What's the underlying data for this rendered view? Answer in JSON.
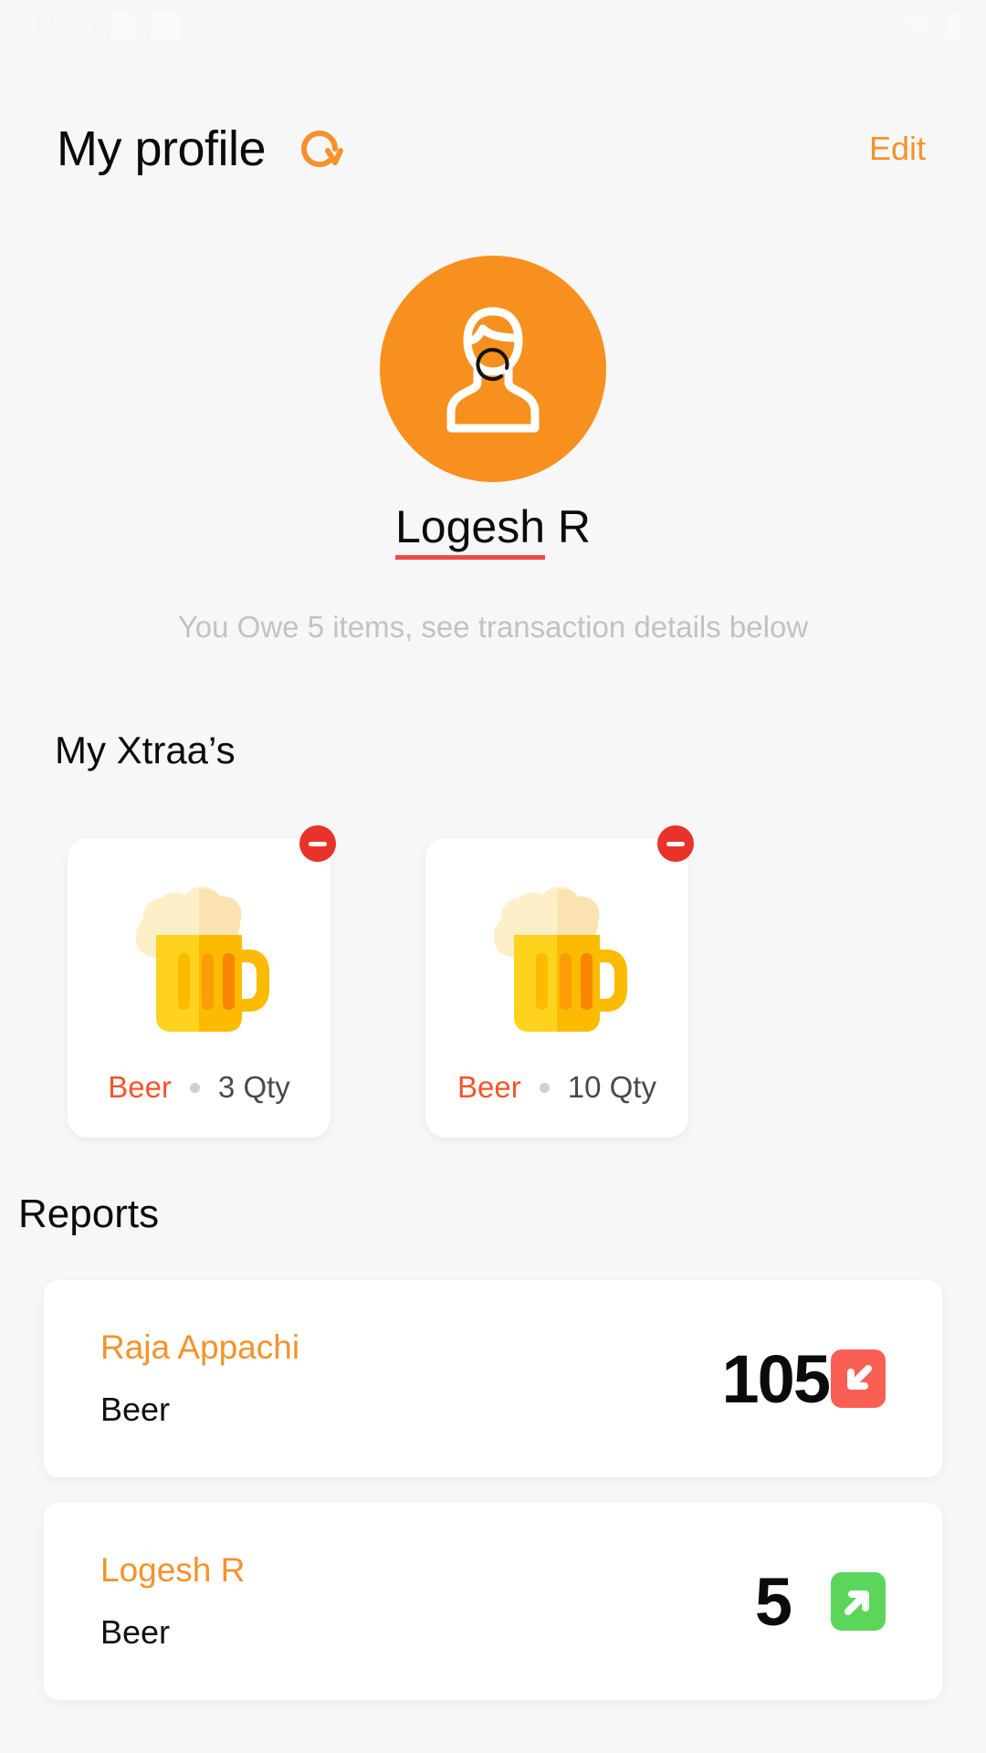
{
  "status_bar": {
    "time": "11:24",
    "icons": [
      "app-square-icon",
      "app-square-icon",
      "wifi-icon",
      "battery-icon"
    ]
  },
  "header": {
    "title": "My profile",
    "refresh_icon": "refresh-icon",
    "edit_label": "Edit"
  },
  "profile": {
    "avatar_icon": "person-avatar-icon",
    "avatar_color": "#F7901E",
    "spinner_icon": "loading-spinner-icon",
    "name_first": "Logesh",
    "name_last": " R",
    "subtitle": "You Owe 5 items, see transaction details below",
    "underline_color": "#EE4B4B"
  },
  "xtraa": {
    "section_title": "My Xtraa’s",
    "items": [
      {
        "image_icon": "beer-mug-icon",
        "name": "Beer",
        "qty": "3 Qty",
        "remove_icon": "minus-circle-icon",
        "remove_color": "#E8332A"
      },
      {
        "image_icon": "beer-mug-icon",
        "name": "Beer",
        "qty": "10 Qty",
        "remove_icon": "minus-circle-icon",
        "remove_color": "#E8332A"
      }
    ]
  },
  "reports": {
    "section_title": "Reports",
    "rows": [
      {
        "person": "Raja Appachi",
        "item": "Beer",
        "value": "105",
        "direction_icon": "arrow-down-left-icon",
        "badge_color": "#FA5F55"
      },
      {
        "person": "Logesh R",
        "item": "Beer",
        "value": "5",
        "direction_icon": "arrow-up-right-icon",
        "badge_color": "#5BD65B"
      }
    ]
  },
  "colors": {
    "background": "#F7F7F7",
    "card": "#FFFFFF",
    "accent_orange": "#F5922C",
    "item_orange": "#F4552B",
    "muted_text": "#C2C2C2"
  }
}
